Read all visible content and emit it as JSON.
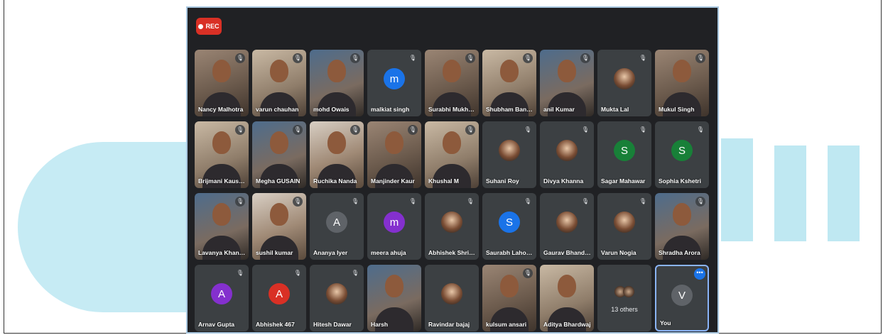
{
  "recording": {
    "label": "REC"
  },
  "colors": {
    "rec": "#d93025",
    "tile": "#3c4043",
    "meet_bg": "#202124",
    "you_border": "#8ab4f8"
  },
  "participants": [
    {
      "name": "Nancy Malhotra",
      "kind": "video",
      "muted": true
    },
    {
      "name": "varun chauhan",
      "kind": "video",
      "muted": true
    },
    {
      "name": "mohd Owais",
      "kind": "video",
      "muted": true
    },
    {
      "name": "malkiat singh",
      "kind": "initial",
      "initial": "m",
      "color": "#1a73e8",
      "muted": true
    },
    {
      "name": "Surabhi Mukhe...",
      "kind": "video",
      "muted": true
    },
    {
      "name": "Shubham Bansal",
      "kind": "video",
      "muted": true
    },
    {
      "name": "anil Kumar",
      "kind": "video",
      "muted": true
    },
    {
      "name": "Mukta Lal",
      "kind": "photo",
      "muted": true
    },
    {
      "name": "Mukul Singh",
      "kind": "video",
      "muted": true
    },
    {
      "name": "Brijmani Kaushik",
      "kind": "video",
      "muted": true
    },
    {
      "name": "Megha GUSAIN",
      "kind": "video",
      "muted": true
    },
    {
      "name": "Ruchika Nanda",
      "kind": "video",
      "muted": true
    },
    {
      "name": "Manjinder Kaur",
      "kind": "video",
      "muted": true
    },
    {
      "name": "Khushal M",
      "kind": "video",
      "muted": true
    },
    {
      "name": "Suhani Roy",
      "kind": "photo",
      "muted": true
    },
    {
      "name": "Divya Khanna",
      "kind": "photo",
      "muted": true
    },
    {
      "name": "Sagar Mahawar",
      "kind": "initial",
      "initial": "S",
      "color": "#188038",
      "muted": true
    },
    {
      "name": "Sophia Kshetri",
      "kind": "initial",
      "initial": "S",
      "color": "#188038",
      "muted": true
    },
    {
      "name": "Lavanya Khand...",
      "kind": "video",
      "muted": true
    },
    {
      "name": "sushil kumar",
      "kind": "video",
      "muted": true
    },
    {
      "name": "Ananya Iyer",
      "kind": "initial",
      "initial": "A",
      "color": "#5f6368",
      "muted": true
    },
    {
      "name": "meera ahuja",
      "kind": "initial",
      "initial": "m",
      "color": "#8430ce",
      "muted": true
    },
    {
      "name": "Abhishek Shriv...",
      "kind": "photo",
      "muted": true
    },
    {
      "name": "Saurabh Lahoria",
      "kind": "initial",
      "initial": "S",
      "color": "#1a73e8",
      "muted": true
    },
    {
      "name": "Gaurav Bhandari",
      "kind": "photo",
      "muted": true
    },
    {
      "name": "Varun Nogia",
      "kind": "photo",
      "muted": true
    },
    {
      "name": "Shradha Arora",
      "kind": "video",
      "muted": true
    },
    {
      "name": "Arnav Gupta",
      "kind": "initial",
      "initial": "A",
      "color": "#8430ce",
      "muted": true
    },
    {
      "name": "Abhishek 467",
      "kind": "initial",
      "initial": "A",
      "color": "#d93025",
      "muted": true
    },
    {
      "name": "Hitesh Dawar",
      "kind": "photo",
      "muted": true
    },
    {
      "name": "Harsh",
      "kind": "video",
      "muted": false
    },
    {
      "name": "Ravindar bajaj",
      "kind": "photo",
      "muted": false
    },
    {
      "name": "kulsum ansari",
      "kind": "video",
      "muted": true
    },
    {
      "name": "Aditya Bhardwaj",
      "kind": "video",
      "muted": false
    },
    {
      "name": "13 others",
      "kind": "others"
    },
    {
      "name": "You",
      "kind": "initial",
      "initial": "V",
      "color": "#5f6368",
      "self": true,
      "more_label": "•••"
    }
  ]
}
